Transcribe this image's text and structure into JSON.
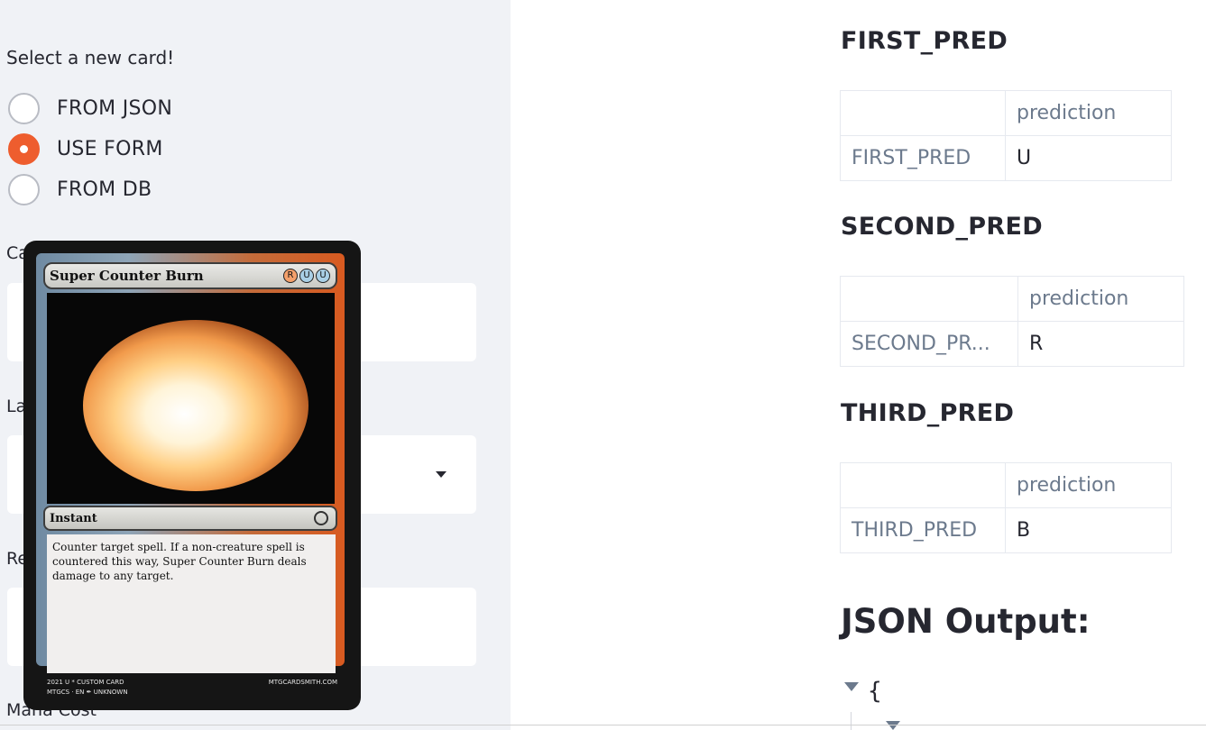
{
  "sidebar": {
    "select_label": "Select a new card!",
    "radio_options": [
      {
        "label": "FROM JSON",
        "checked": false
      },
      {
        "label": "USE FORM",
        "checked": true
      },
      {
        "label": "FROM DB",
        "checked": false
      }
    ],
    "field_labels": {
      "card_name_partial": "Ca",
      "language_partial": "La",
      "rarity_partial": "Re",
      "mana_cost": "Mana Cost"
    },
    "accent_color": "#ee5d2e"
  },
  "card": {
    "name": "Super Counter Burn",
    "mana_symbols": [
      "R",
      "U",
      "U"
    ],
    "type_line": "Instant",
    "rules_text": "Counter target spell. If a non-creature spell is countered this way, Super Counter Burn deals damage to any target.",
    "footer_left_1": "2021 U * CUSTOM CARD",
    "footer_left_2": "MTGCS · EN ✒ UNKNOWN",
    "footer_right": "MTGCARDSMITH.COM"
  },
  "predictions": [
    {
      "title": "FIRST_PRED",
      "header": "prediction",
      "index": "FIRST_PRED",
      "value": "U"
    },
    {
      "title": "SECOND_PRED",
      "header": "prediction",
      "index": "SECOND_PR...",
      "value": "R"
    },
    {
      "title": "THIRD_PRED",
      "header": "prediction",
      "index": "THIRD_PRED",
      "value": "B"
    }
  ],
  "json_output": {
    "title": "JSON Output:",
    "open_brace": "{"
  }
}
